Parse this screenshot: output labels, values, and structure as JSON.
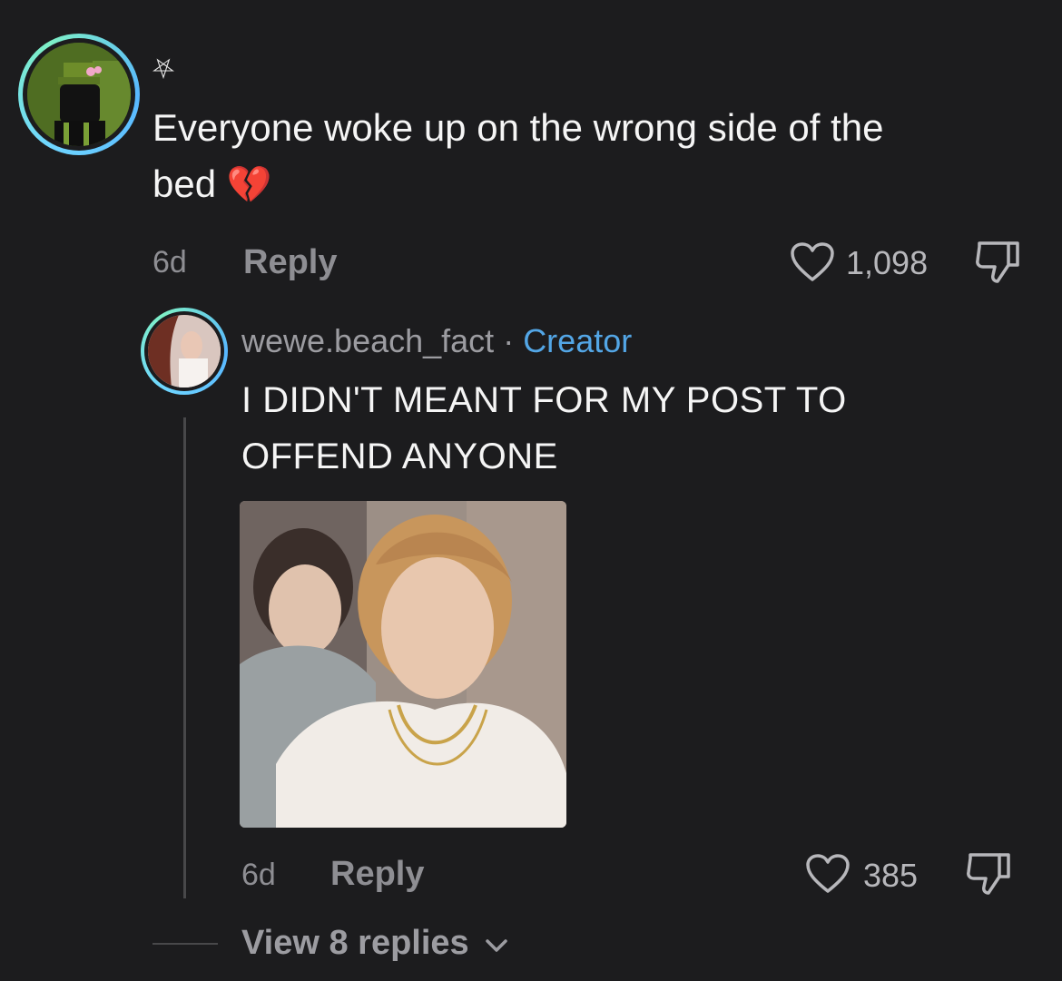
{
  "comment": {
    "username_symbol": "⛧",
    "text_line1": "Everyone woke up on the wrong side of the",
    "text_line2": "bed",
    "emoji": "💔",
    "time": "6d",
    "reply_label": "Reply",
    "like_count": "1,098"
  },
  "reply": {
    "username": "wewe.beach_fact",
    "separator": " · ",
    "badge": "Creator",
    "text_line1": "I DIDN'T MEANT FOR MY POST TO",
    "text_line2": "OFFEND ANYONE",
    "time": "6d",
    "reply_label": "Reply",
    "like_count": "385"
  },
  "thread": {
    "view_replies_label": "View 8 replies"
  },
  "icons": {
    "like": "heart-outline-icon",
    "dislike": "thumbs-down-icon",
    "expand": "chevron-down-icon"
  },
  "colors": {
    "background": "#1c1c1e",
    "creator_badge": "#53a6e6",
    "avatar_ring": "#6fd6ff"
  }
}
